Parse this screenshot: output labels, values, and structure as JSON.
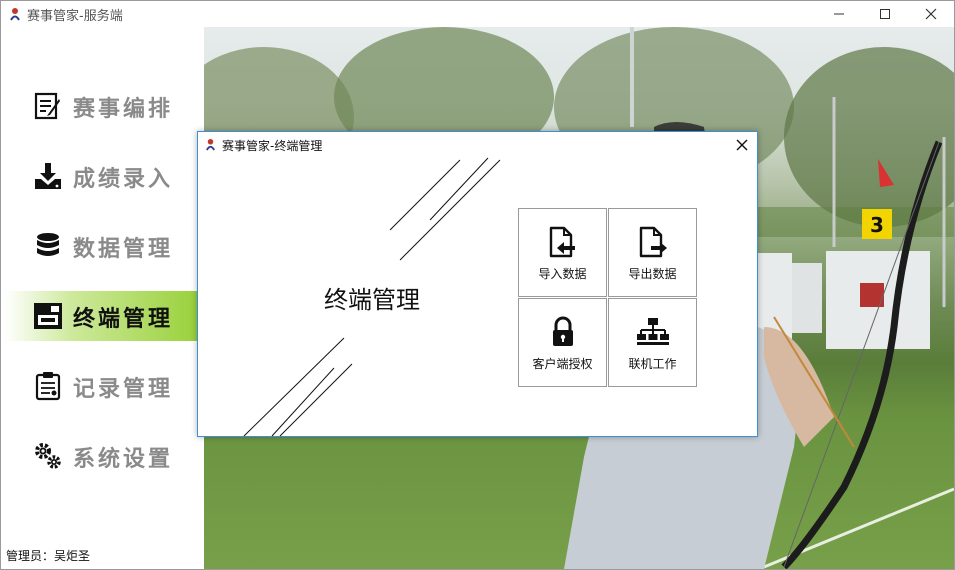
{
  "window": {
    "title": "赛事管家-服务端"
  },
  "sidebar": {
    "items": [
      {
        "label": "赛事编排",
        "icon": "schedule-icon"
      },
      {
        "label": "成绩录入",
        "icon": "download-icon"
      },
      {
        "label": "数据管理",
        "icon": "database-icon"
      },
      {
        "label": "终端管理",
        "icon": "terminal-icon",
        "active": true
      },
      {
        "label": "记录管理",
        "icon": "clipboard-icon"
      },
      {
        "label": "系统设置",
        "icon": "gears-icon"
      }
    ],
    "admin": "管理员：吴炬圣"
  },
  "dialog": {
    "title": "赛事管家-终端管理",
    "heading": "终端管理",
    "tiles": [
      {
        "label": "导入数据",
        "icon": "file-import-icon"
      },
      {
        "label": "导出数据",
        "icon": "file-export-icon"
      },
      {
        "label": "客户端授权",
        "icon": "lock-icon"
      },
      {
        "label": "联机工作",
        "icon": "network-icon"
      }
    ]
  },
  "background": {
    "target_number": "3"
  },
  "colors": {
    "active_nav": "#9ad13c",
    "dialog_border": "#3d8fd6"
  }
}
